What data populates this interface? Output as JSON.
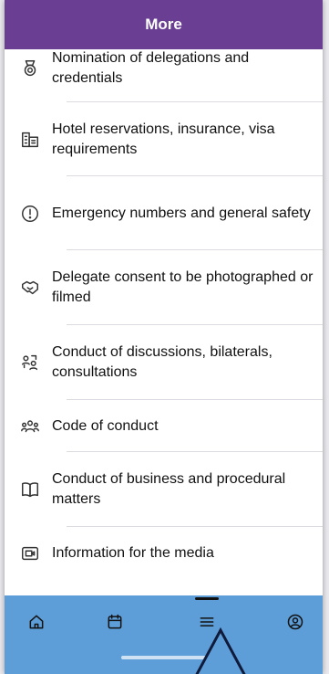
{
  "header": {
    "title": "More"
  },
  "menu": {
    "items": [
      {
        "icon": "medal-icon",
        "label": "Nomination of delegations and credentials"
      },
      {
        "icon": "hotel-icon",
        "label": "Hotel reservations, insurance, visa requirements"
      },
      {
        "icon": "alert-circle-icon",
        "label": "Emergency numbers and general safety"
      },
      {
        "icon": "handshake-icon",
        "label": "Delegate consent to be photographed or filmed"
      },
      {
        "icon": "discussion-users-icon",
        "label": "Conduct of discussions, bilaterals, consultations"
      },
      {
        "icon": "people-group-icon",
        "label": "Code of conduct"
      },
      {
        "icon": "book-open-icon",
        "label": "Conduct of business and procedural matters"
      },
      {
        "icon": "media-icon",
        "label": "Information for the media"
      }
    ]
  },
  "tabbar": {
    "tabs": [
      {
        "icon": "home-icon"
      },
      {
        "icon": "calendar-icon"
      },
      {
        "icon": "menu-icon",
        "active": true
      },
      {
        "icon": "profile-icon"
      }
    ]
  },
  "colors": {
    "header": "#6a3f93",
    "tabbar": "#5d9ed8"
  }
}
